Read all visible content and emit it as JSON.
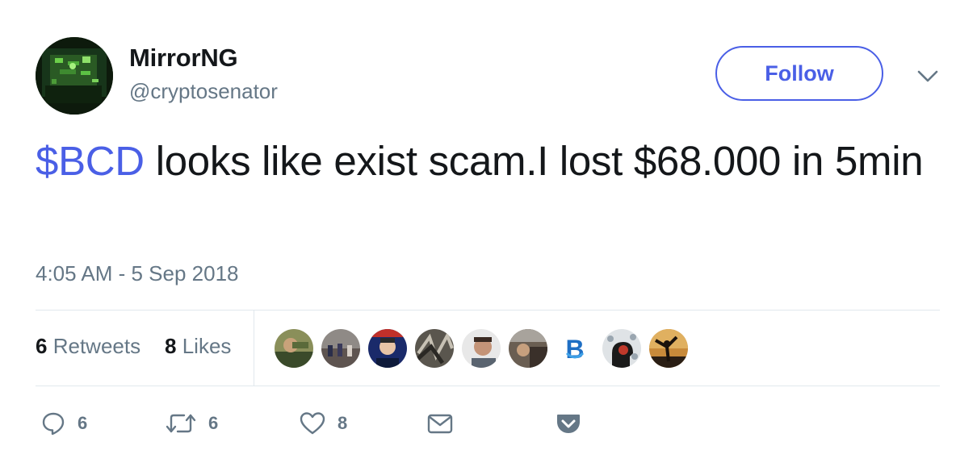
{
  "user": {
    "display_name": "MirrorNG",
    "handle": "@cryptosenator",
    "avatar_icon": "user-avatar"
  },
  "follow_button": {
    "label": "Follow"
  },
  "tweet": {
    "cashtag": "$BCD",
    "text": " looks like exist scam.I lost $68.000 in 5min",
    "timestamp": "4:05 AM - 5 Sep 2018"
  },
  "stats": {
    "retweets_count": "6",
    "retweets_label": "Retweets",
    "likes_count": "8",
    "likes_label": "Likes"
  },
  "likers": [
    {
      "icon": "liker-avatar"
    },
    {
      "icon": "liker-avatar"
    },
    {
      "icon": "liker-avatar"
    },
    {
      "icon": "liker-avatar"
    },
    {
      "icon": "liker-avatar"
    },
    {
      "icon": "liker-avatar"
    },
    {
      "icon": "liker-avatar"
    },
    {
      "icon": "liker-avatar"
    },
    {
      "icon": "liker-avatar"
    }
  ],
  "actions": {
    "reply_count": "6",
    "retweet_count": "6",
    "like_count": "8"
  },
  "colors": {
    "accent": "#4a5fe6",
    "text_primary": "#14171a",
    "text_secondary": "#657786",
    "divider": "#e1e8ed"
  }
}
